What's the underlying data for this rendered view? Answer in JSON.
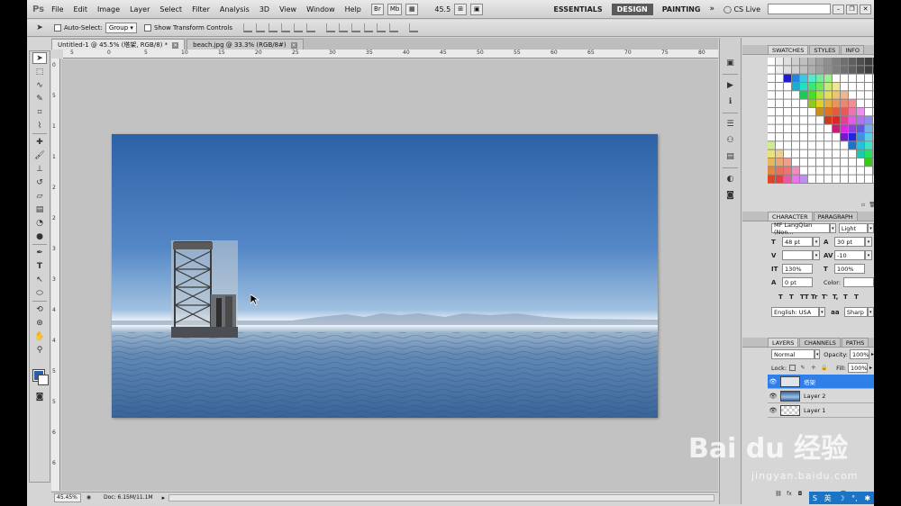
{
  "menubar": {
    "logo": "Ps",
    "items": [
      "File",
      "Edit",
      "Image",
      "Layer",
      "Select",
      "Filter",
      "Analysis",
      "3D",
      "View",
      "Window",
      "Help"
    ],
    "icons": [
      "Br",
      "Mb"
    ],
    "zoom": "45.5",
    "workspaces": [
      "ESSENTIALS",
      "DESIGN",
      "PAINTING"
    ],
    "active_workspace": "DESIGN",
    "cslive": "CS Live"
  },
  "options_bar": {
    "auto_select_label": "Auto-Select:",
    "auto_select_value": "Group",
    "show_transform_label": "Show Transform Controls"
  },
  "tabs": [
    {
      "label": "Untitled-1 @ 45.5% (塔架, RGB/8) *",
      "active": true
    },
    {
      "label": "beach.jpg @ 33.3% (RGB/8#)",
      "active": false
    }
  ],
  "ruler": {
    "h_labels": [
      "5",
      "0",
      "5",
      "10",
      "15",
      "20",
      "25",
      "30",
      "35",
      "40",
      "45",
      "50",
      "55",
      "60",
      "65",
      "70",
      "75",
      "80"
    ],
    "v_labels": [
      "0",
      "5",
      "1",
      "1",
      "2",
      "2",
      "3",
      "3",
      "4",
      "4",
      "5",
      "5",
      "6",
      "6"
    ]
  },
  "status": {
    "zoom": "45.45%",
    "doc": "Doc: 6.15M/11.1M"
  },
  "swatches_panel": {
    "tabs": [
      "SWATCHES",
      "STYLES",
      "INFO"
    ]
  },
  "character_panel": {
    "tabs": [
      "CHARACTER",
      "PARAGRAPH"
    ],
    "font_family": "MF LangQian (Non...",
    "font_style": "Light",
    "font_size": "48 pt",
    "leading": "30 pt",
    "kerning": "",
    "tracking": "-10",
    "vscale": "130%",
    "hscale": "100%",
    "baseline": "0 pt",
    "color_label": "Color:",
    "style_buttons": [
      "T",
      "T",
      "TT",
      "Tr",
      "T'",
      "T,",
      "T",
      "T"
    ],
    "language": "English: USA",
    "aa_label": "a",
    "aa_value": "Sharp"
  },
  "layers_panel": {
    "tabs": [
      "LAYERS",
      "CHANNELS",
      "PATHS"
    ],
    "blend_mode": "Normal",
    "opacity_label": "Opacity:",
    "opacity": "100%",
    "lock_label": "Lock:",
    "fill_label": "Fill:",
    "fill": "100%",
    "layers": [
      {
        "name": "塔架",
        "selected": true
      },
      {
        "name": "Layer 2",
        "selected": false
      },
      {
        "name": "Layer 1",
        "selected": false
      }
    ]
  },
  "ime": {
    "lang": "英"
  },
  "watermark": {
    "brand": "Bai du 经验",
    "url": "jingyan.baidu.com"
  },
  "colors": {
    "foreground": "#2a5ea8",
    "background": "#ffffff",
    "selection": "#2f7fe8",
    "active_workspace": "#5a5a5a"
  }
}
